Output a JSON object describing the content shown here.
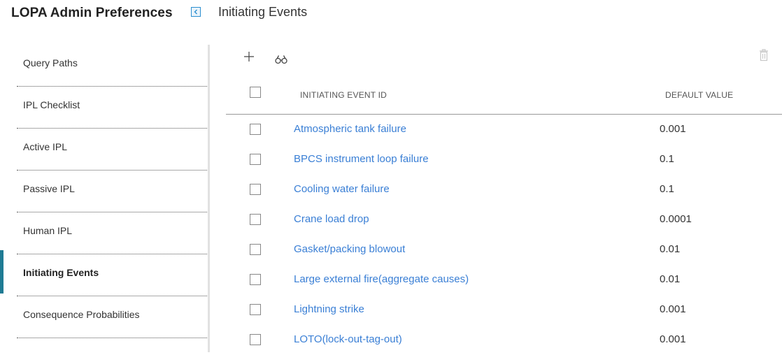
{
  "header": {
    "app_title": "LOPA Admin Preferences",
    "page_title": "Initiating Events"
  },
  "sidebar": {
    "items": [
      {
        "label": "Query Paths",
        "active": false
      },
      {
        "label": "IPL Checklist",
        "active": false
      },
      {
        "label": "Active IPL",
        "active": false
      },
      {
        "label": "Passive IPL",
        "active": false
      },
      {
        "label": "Human IPL",
        "active": false
      },
      {
        "label": "Initiating Events",
        "active": true
      },
      {
        "label": "Consequence Probabilities",
        "active": false
      }
    ]
  },
  "toolbar": {
    "add_icon": "plus-icon",
    "find_icon": "binoculars-icon",
    "delete_icon": "trash-icon"
  },
  "table": {
    "columns": [
      "INITIATING EVENT ID",
      "DEFAULT VALUE"
    ],
    "rows": [
      {
        "id": "Atmospheric tank failure",
        "value": "0.001"
      },
      {
        "id": "BPCS instrument loop failure",
        "value": "0.1"
      },
      {
        "id": "Cooling water failure",
        "value": "0.1"
      },
      {
        "id": "Crane load drop",
        "value": "0.0001"
      },
      {
        "id": "Gasket/packing blowout",
        "value": "0.01"
      },
      {
        "id": "Large external fire(aggregate causes)",
        "value": "0.01"
      },
      {
        "id": "Lightning strike",
        "value": "0.001"
      },
      {
        "id": "LOTO(lock-out-tag-out)",
        "value": "0.001"
      }
    ]
  },
  "colors": {
    "link": "#3a7fd5",
    "active_accent": "#1f7b94",
    "collapse_button": "#2d8fd0"
  }
}
